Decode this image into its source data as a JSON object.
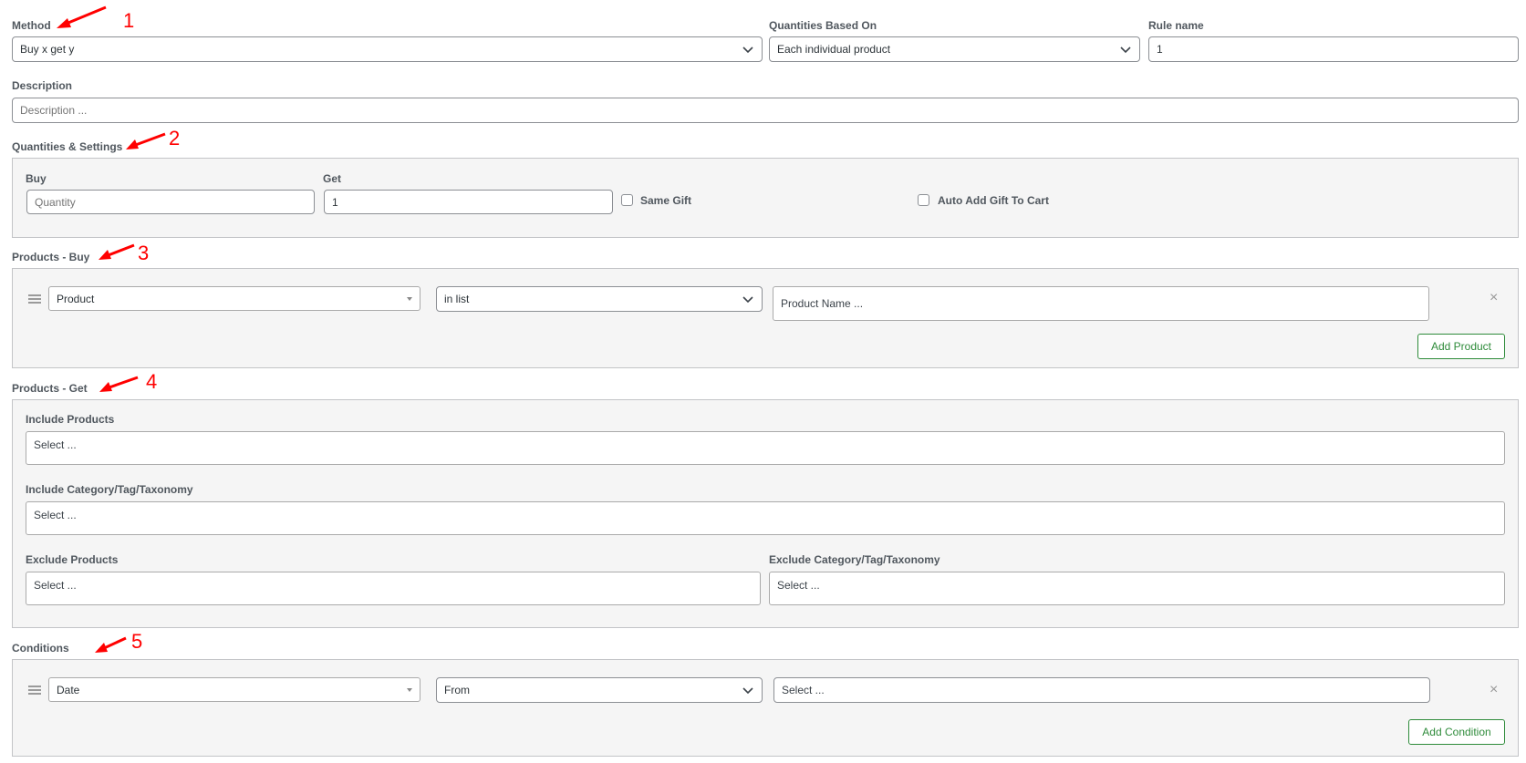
{
  "top": {
    "method": {
      "label": "Method",
      "value": "Buy x get y"
    },
    "quantities_based_on": {
      "label": "Quantities Based On",
      "value": "Each individual product"
    },
    "rule_name": {
      "label": "Rule name",
      "value": "1"
    },
    "description": {
      "label": "Description",
      "placeholder": "Description ..."
    }
  },
  "qty_settings": {
    "title": "Quantities & Settings",
    "buy": {
      "label": "Buy",
      "placeholder": "Quantity"
    },
    "get": {
      "label": "Get",
      "value": "1"
    },
    "same_gift_label": "Same Gift",
    "auto_add_label": "Auto Add Gift To Cart"
  },
  "products_buy": {
    "title": "Products - Buy",
    "type_value": "Product",
    "operator_value": "in list",
    "name_placeholder": "Product Name ...",
    "remove_glyph": "×",
    "add_label": "Add Product"
  },
  "products_get": {
    "title": "Products - Get",
    "include_products": {
      "label": "Include Products",
      "placeholder": "Select ..."
    },
    "include_category": {
      "label": "Include Category/Tag/Taxonomy",
      "placeholder": "Select ..."
    },
    "exclude_products": {
      "label": "Exclude Products",
      "placeholder": "Select ..."
    },
    "exclude_category": {
      "label": "Exclude Category/Tag/Taxonomy",
      "placeholder": "Select ..."
    }
  },
  "conditions": {
    "title": "Conditions",
    "type_value": "Date",
    "operator_value": "From",
    "value_placeholder": "Select ...",
    "remove_glyph": "×",
    "add_label": "Add Condition"
  },
  "annotations": [
    "1",
    "2",
    "3",
    "4",
    "5"
  ],
  "icons": {
    "select_arrow": "chevron-down-icon",
    "small_arrow": "triangle-down-icon",
    "drag": "drag-handle-icon",
    "remove": "close-icon",
    "annotation_arrow": "red-arrow-icon"
  },
  "colors": {
    "accent_green": "#2e8b3a",
    "annotation_red": "#ff0000",
    "panel_bg": "#f5f5f5",
    "border": "#8c8f94"
  }
}
